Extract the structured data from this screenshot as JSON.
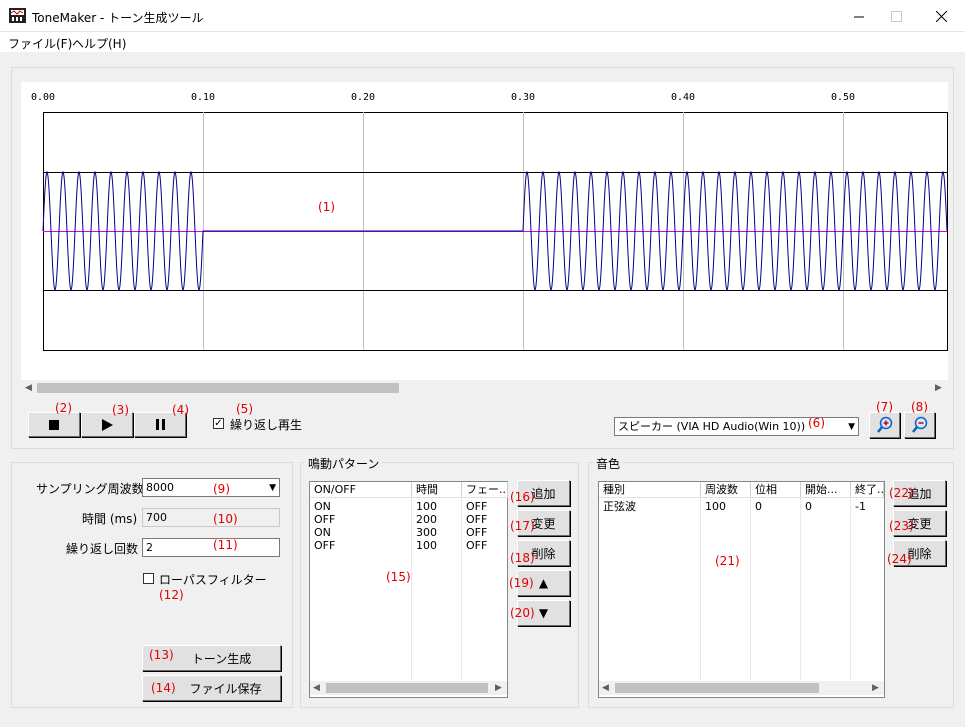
{
  "window": {
    "title": "ToneMaker - トーン生成ツール"
  },
  "menu": {
    "file": "ファイル(F)",
    "help": "ヘルプ(H)"
  },
  "waveform": {
    "ticks": [
      "0.00",
      "0.10",
      "0.20",
      "0.30",
      "0.40",
      "0.50"
    ],
    "annotation": "(1)",
    "segments": [
      {
        "state": "ON",
        "start_s": 0.0,
        "end_s": 0.1
      },
      {
        "state": "OFF",
        "start_s": 0.1,
        "end_s": 0.3
      },
      {
        "state": "ON",
        "start_s": 0.3,
        "end_s": 0.6
      }
    ],
    "colors": {
      "wave": "#00008b",
      "center": "#e000e0",
      "grid": "#c0c0c0"
    }
  },
  "transport": {
    "stop_icon": "stop-icon",
    "play_icon": "play-icon",
    "pause_icon": "pause-icon",
    "ann_stop": "(2)",
    "ann_play": "(3)",
    "ann_pause": "(4)",
    "repeat_label": "繰り返し再生",
    "repeat_checked": true,
    "ann_repeat": "(5)"
  },
  "device": {
    "value": "スピーカー (VIA HD Audio(Win 10))",
    "ann": "(6)"
  },
  "zoom": {
    "ann_in": "(7)",
    "ann_out": "(8)",
    "in_icon": "zoom-in-icon",
    "out_icon": "zoom-out-icon"
  },
  "settings": {
    "sampling_label": "サンプリング周波数",
    "sampling_value": "8000",
    "ann_sampling": "(9)",
    "time_label": "時間 (ms)",
    "time_value": "700",
    "ann_time": "(10)",
    "repeat_count_label": "繰り返し回数",
    "repeat_count_value": "2",
    "ann_repeat_count": "(11)",
    "lowpass_label": "ローパスフィルター",
    "lowpass_checked": false,
    "ann_lowpass": "(12)",
    "generate_label": "トーン生成",
    "ann_generate": "(13)",
    "save_label": "ファイル保存",
    "ann_save": "(14)"
  },
  "pattern": {
    "group_label": "鳴動パターン",
    "columns": [
      "ON/OFF",
      "時間",
      "フェー..."
    ],
    "rows": [
      [
        "ON",
        "100",
        "OFF"
      ],
      [
        "OFF",
        "200",
        "OFF"
      ],
      [
        "ON",
        "300",
        "OFF"
      ],
      [
        "OFF",
        "100",
        "OFF"
      ]
    ],
    "ann_list": "(15)",
    "add_label": "追加",
    "ann_add": "(16)",
    "edit_label": "変更",
    "ann_edit": "(17)",
    "delete_label": "削除",
    "ann_delete": "(18)",
    "up_label": "▲",
    "ann_up": "(19)",
    "down_label": "▼",
    "ann_down": "(20)"
  },
  "tone": {
    "group_label": "音色",
    "columns": [
      "種別",
      "周波数",
      "位相",
      "開始...",
      "終了..."
    ],
    "rows": [
      [
        "正弦波",
        "100",
        "0",
        "0",
        "-1"
      ]
    ],
    "ann_list": "(21)",
    "add_label": "追加",
    "ann_add": "(22)",
    "edit_label": "変更",
    "ann_edit": "(23)",
    "delete_label": "削除",
    "ann_delete": "(24)"
  }
}
